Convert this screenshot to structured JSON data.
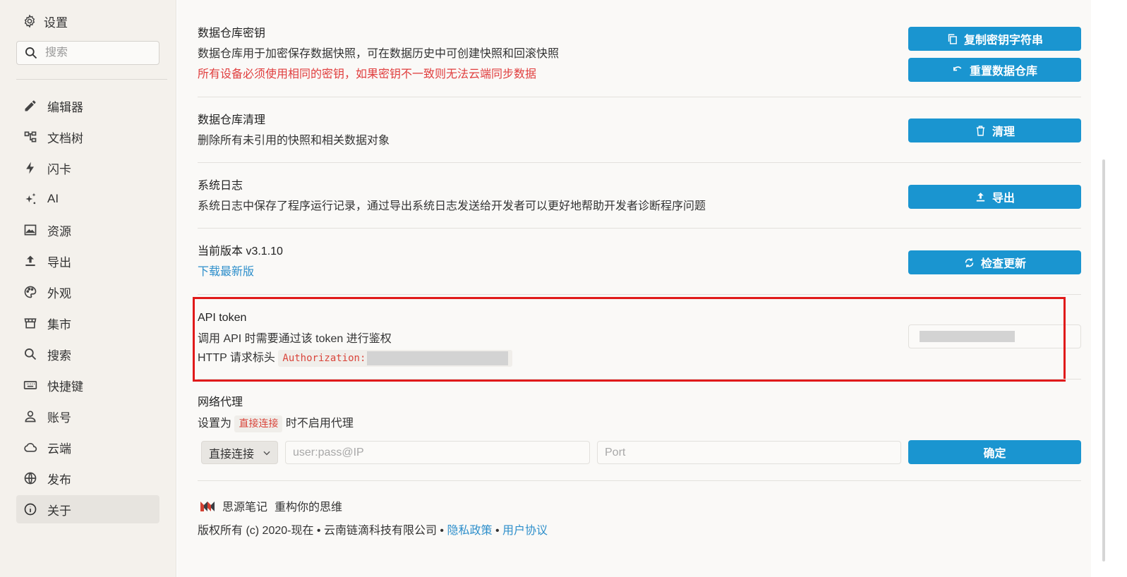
{
  "sidebar": {
    "title": "设置",
    "search_placeholder": "搜索",
    "items": [
      {
        "label": "编辑器",
        "icon": "pencil-icon"
      },
      {
        "label": "文档树",
        "icon": "tree-icon"
      },
      {
        "label": "闪卡",
        "icon": "lightning-icon"
      },
      {
        "label": "AI",
        "icon": "sparkle-icon"
      },
      {
        "label": "资源",
        "icon": "image-icon"
      },
      {
        "label": "导出",
        "icon": "upload-icon"
      },
      {
        "label": "外观",
        "icon": "palette-icon"
      },
      {
        "label": "集市",
        "icon": "store-icon"
      },
      {
        "label": "搜索",
        "icon": "search-icon"
      },
      {
        "label": "快捷键",
        "icon": "keyboard-icon"
      },
      {
        "label": "账号",
        "icon": "user-icon"
      },
      {
        "label": "云端",
        "icon": "cloud-icon"
      },
      {
        "label": "发布",
        "icon": "globe-icon"
      },
      {
        "label": "关于",
        "icon": "info-icon",
        "active": true
      }
    ]
  },
  "repo_key": {
    "title": "数据仓库密钥",
    "desc": "数据仓库用于加密保存数据快照，可在数据历史中可创建快照和回滚快照",
    "warning": "所有设备必须使用相同的密钥，如果密钥不一致则无法云端同步数据",
    "copy_button": "复制密钥字符串",
    "reset_button": "重置数据仓库"
  },
  "repo_purge": {
    "title": "数据仓库清理",
    "desc": "删除所有未引用的快照和相关数据对象",
    "button": "清理"
  },
  "system_log": {
    "title": "系统日志",
    "desc": "系统日志中保存了程序运行记录，通过导出系统日志发送给开发者可以更好地帮助开发者诊断程序问题",
    "button": "导出"
  },
  "version": {
    "title": "当前版本 v3.1.10",
    "download_link": "下载最新版",
    "button": "检查更新"
  },
  "api_token": {
    "title": "API token",
    "desc": "调用 API 时需要通过该 token 进行鉴权",
    "header_label": "HTTP 请求标头",
    "header_code": "Authorization:"
  },
  "proxy": {
    "title": "网络代理",
    "desc_prefix": "设置为",
    "desc_chip": "直接连接",
    "desc_suffix": "时不启用代理",
    "select_value": "直接连接",
    "host_placeholder": "user:pass@IP",
    "port_placeholder": "Port",
    "confirm_button": "确定"
  },
  "footer": {
    "app_name": "思源笔记",
    "slogan": "重构你的思维",
    "copyright": "版权所有 (c) 2020-现在 • 云南链滴科技有限公司 •",
    "privacy_link": "隐私政策",
    "separator": "•",
    "terms_link": "用户协议"
  },
  "colors": {
    "accent": "#1a95d0",
    "warning": "#e03e3e",
    "highlight_border": "#e01a1a",
    "link": "#2e8fcb"
  }
}
